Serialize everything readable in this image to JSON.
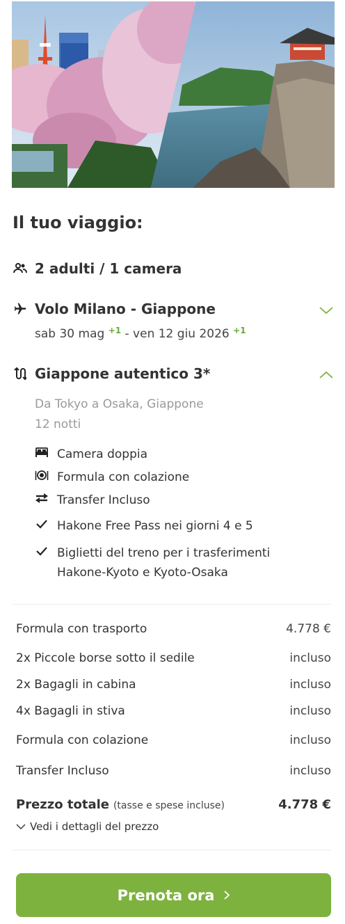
{
  "hero": {
    "image_desc": ""
  },
  "trip": {
    "title": "Il tuo viaggio:",
    "guests": {
      "icon": "people-icon",
      "label": "2 adulti / 1 camera"
    },
    "flight": {
      "icon": "airplane-icon",
      "label": "Volo Milano - Giappone",
      "date_out": "sab 30 mag",
      "sup_out": "+1",
      "date_sep": " - ",
      "date_back": "ven 12 giu 2026",
      "sup_back": "+1"
    },
    "package": {
      "icon": "route-icon",
      "label": "Giappone autentico 3*",
      "route": "Da Tokyo a Osaka, Giappone",
      "nights": "12 notti",
      "features": [
        {
          "icon": "bed-icon",
          "text": "Camera doppia"
        },
        {
          "icon": "dining-icon",
          "text": "Formula con colazione"
        },
        {
          "icon": "transfer-arrows-icon",
          "text": "Transfer Incluso"
        },
        {
          "icon": "check-icon",
          "text": "Hakone Free Pass nei giorni 4 e 5"
        },
        {
          "icon": "check-icon",
          "text": "Biglietti del treno per i trasferimenti Hakone-Kyoto e Kyoto-Osaka"
        }
      ]
    }
  },
  "prices": {
    "rows": [
      {
        "label": "Formula con trasporto",
        "value": "4.778 €"
      },
      {
        "label": "2x Piccole borse sotto il sedile",
        "value": "incluso"
      },
      {
        "label": "2x Bagagli in cabina",
        "value": "incluso"
      },
      {
        "label": "4x Bagagli in stiva",
        "value": "incluso"
      },
      {
        "label": "Formula con colazione",
        "value": "incluso"
      },
      {
        "label": "Transfer Incluso",
        "value": "incluso"
      }
    ],
    "total_label": "Prezzo totale",
    "total_note": "(tasse e spese incluse)",
    "total_value": "4.778 €",
    "details_link": "Vedi i dettagli del prezzo"
  },
  "cta": {
    "label": "Prenota ora"
  },
  "colors": {
    "accent": "#7db23e",
    "sup_green": "#6aaa3a",
    "text": "#333333",
    "muted": "#9a9a9a"
  }
}
